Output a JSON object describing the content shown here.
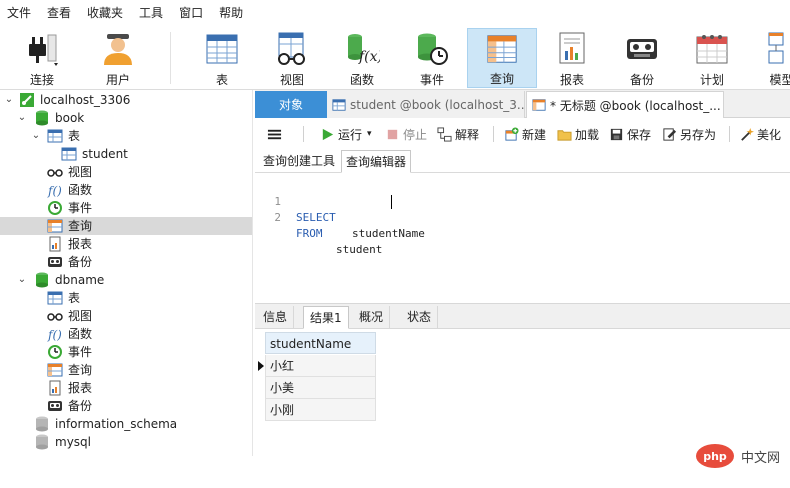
{
  "menu": [
    "文件",
    "查看",
    "收藏夹",
    "工具",
    "窗口",
    "帮助"
  ],
  "toolbar": {
    "connect": "连接",
    "user": "用户",
    "table": "表",
    "view": "视图",
    "function": "函数",
    "event": "事件",
    "query": "查询",
    "report": "报表",
    "backup": "备份",
    "schedule": "计划",
    "model": "模型",
    "active_item": "查询"
  },
  "tree": {
    "connection": "localhost_3306",
    "db1": {
      "name": "book",
      "table_group": "表",
      "tables": [
        "student"
      ],
      "view": "视图",
      "function": "函数",
      "event": "事件",
      "query": "查询",
      "report": "报表",
      "backup": "备份"
    },
    "db2": {
      "name": "dbname",
      "table_group": "表",
      "view": "视图",
      "function": "函数",
      "event": "事件",
      "query": "查询",
      "report": "报表",
      "backup": "备份"
    },
    "db3": "information_schema",
    "db4": "mysql"
  },
  "doc_tabs": {
    "object": "对象",
    "tab1": "student @book (localhost_3...",
    "tab2": "* 无标题 @book (localhost_..."
  },
  "query_toolbar": {
    "run": "运行",
    "stop": "停止",
    "explain": "解释",
    "new": "新建",
    "load": "加载",
    "save": "保存",
    "save_as": "另存为",
    "beautify": "美化"
  },
  "sub_tabs": {
    "builder": "查询创建工具",
    "editor": "查询编辑器"
  },
  "editor": {
    "lines": [
      {
        "num": "1",
        "keyword": "SELECT",
        "rest": "studentName"
      },
      {
        "num": "2",
        "keyword": "FROM",
        "rest": "student"
      }
    ]
  },
  "result_tabs": [
    "信息",
    "结果1",
    "概况",
    "状态"
  ],
  "result_grid": {
    "column": "studentName",
    "rows": [
      "小红",
      "小美",
      "小刚"
    ]
  },
  "watermark": {
    "logo": "php",
    "text": "中文网"
  },
  "colors": {
    "accent": "#3c8fd6",
    "active_toolbar_bg": "#cde6f7",
    "keyword": "#2a5db0",
    "db_icon": "#3aa935"
  }
}
